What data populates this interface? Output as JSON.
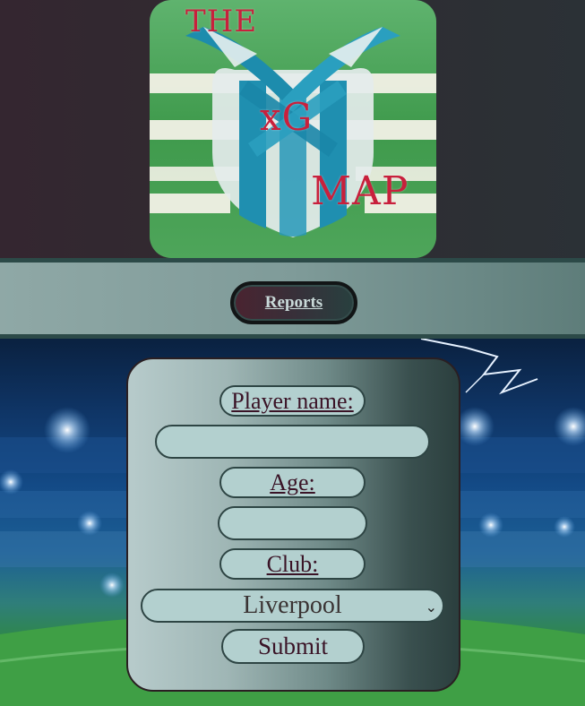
{
  "logo": {
    "line1": "THE",
    "line2": "xG",
    "line3": "MAP"
  },
  "nav": {
    "reports_label": "Reports"
  },
  "form": {
    "player_name_label": "Player name:",
    "player_name_value": "",
    "age_label": "Age:",
    "age_value": "",
    "club_label": "Club:",
    "club_selected": "Liverpool",
    "submit_label": "Submit"
  },
  "icons": {
    "select_chevron": "chevron-down-icon"
  },
  "colors": {
    "logo_text": "#c8203c",
    "nav_border": "#2c4a48",
    "field_bg": "#b3d0cf",
    "label_text": "#3a1326"
  }
}
